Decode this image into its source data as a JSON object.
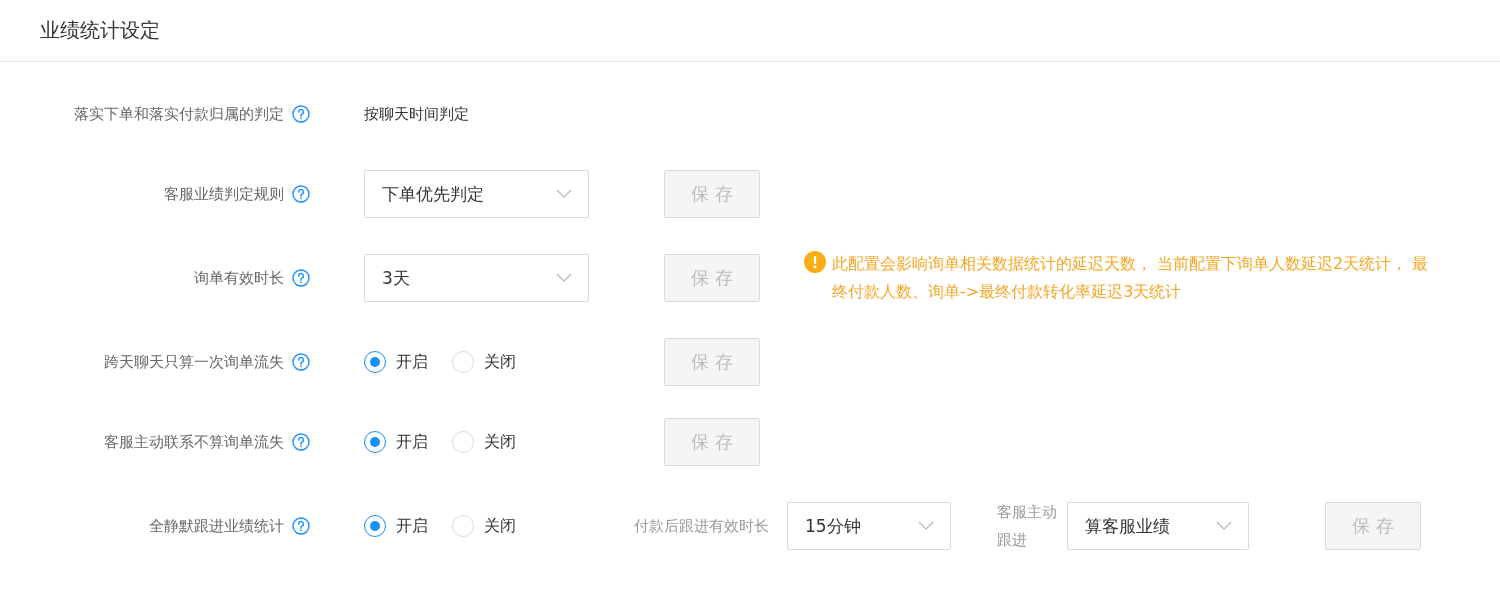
{
  "title": "业绩统计设定",
  "rows": [
    {
      "kind": "text",
      "label": "落实下单和落实付款归属的判定",
      "value": "按聊天时间判定"
    },
    {
      "kind": "select",
      "label": "客服业绩判定规则",
      "value": "下单优先判定",
      "save": {
        "label": "保 存",
        "disabled": true
      }
    },
    {
      "kind": "select",
      "label": "询单有效时长",
      "value": "3天",
      "save": {
        "label": "保 存",
        "disabled": true
      },
      "notice": "此配置会影响询单相关数据统计的延迟天数， 当前配置下询单人数延迟2天统计， 最终付款人数、询单->最终付款转化率延迟3天统计"
    },
    {
      "kind": "radio",
      "label": "跨天聊天只算一次询单流失",
      "options": [
        {
          "label": "开启",
          "selected": true
        },
        {
          "label": "关闭",
          "selected": false
        }
      ],
      "save": {
        "label": "保 存",
        "disabled": true
      }
    },
    {
      "kind": "radio",
      "label": "客服主动联系不算询单流失",
      "options": [
        {
          "label": "开启",
          "selected": true
        },
        {
          "label": "关闭",
          "selected": false
        }
      ],
      "save": {
        "label": "保 存",
        "disabled": true
      }
    },
    {
      "kind": "radio",
      "label": "全静默跟进业绩统计",
      "options": [
        {
          "label": "开启",
          "selected": true
        },
        {
          "label": "关闭",
          "selected": false
        }
      ],
      "extras": [
        {
          "label": "付款后跟进有效时长",
          "value": "15分钟"
        },
        {
          "label": "客服主动跟进",
          "value": "算客服业绩"
        }
      ],
      "save": {
        "label": "保 存",
        "disabled": true
      }
    }
  ]
}
